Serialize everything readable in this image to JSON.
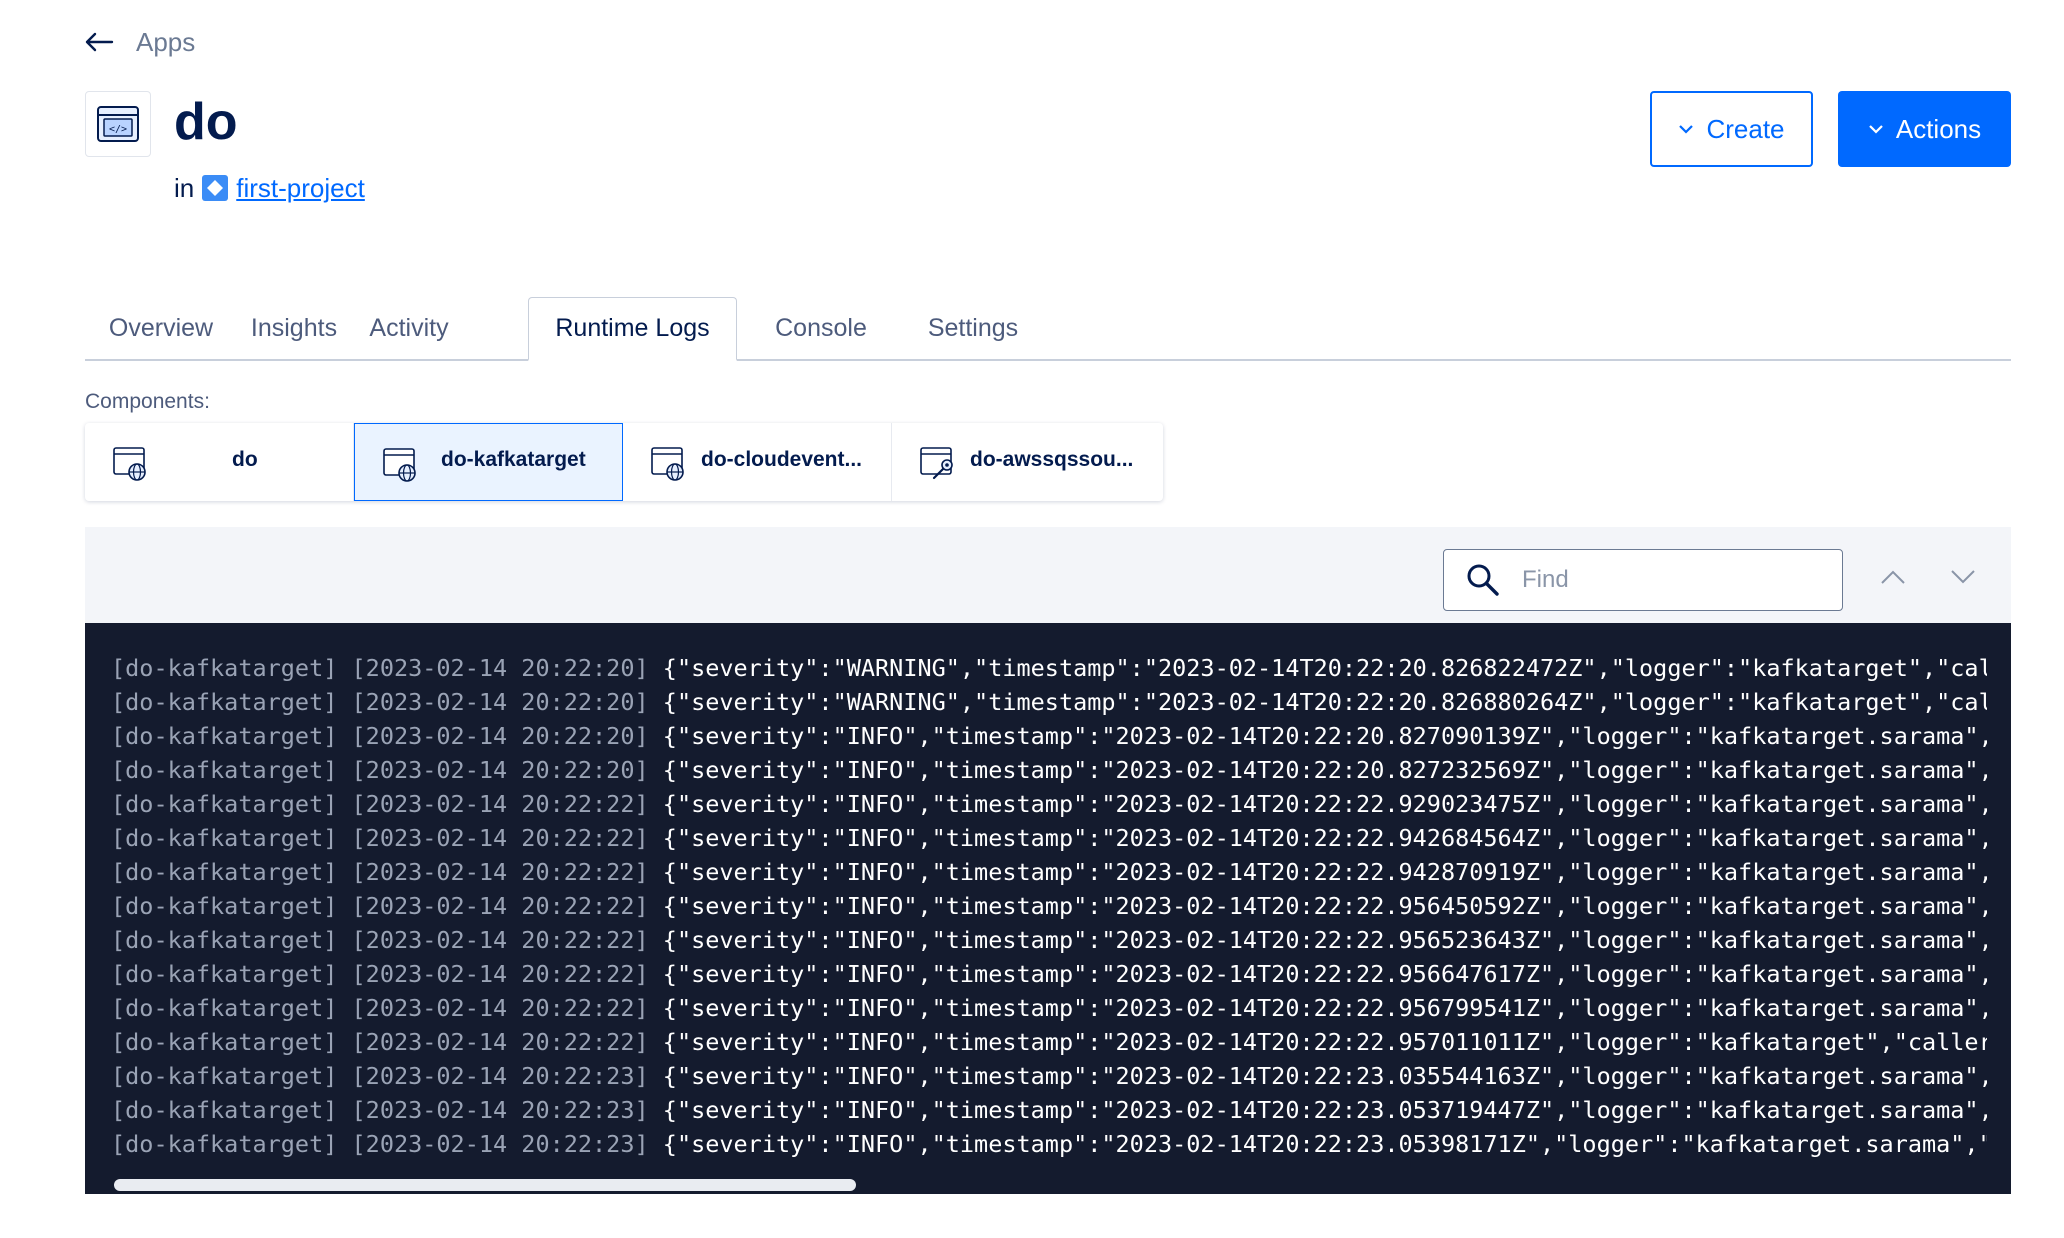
{
  "nav": {
    "back_label": "Apps"
  },
  "app": {
    "title": "do",
    "in_label": "in",
    "project": "first-project"
  },
  "buttons": {
    "create": "Create",
    "actions": "Actions"
  },
  "tabs": [
    {
      "label": "Overview",
      "active": false
    },
    {
      "label": "Insights",
      "active": false
    },
    {
      "label": "Activity",
      "active": false
    },
    {
      "label": "Runtime Logs",
      "active": true
    },
    {
      "label": "Console",
      "active": false
    },
    {
      "label": "Settings",
      "active": false
    }
  ],
  "components": {
    "label": "Components:",
    "items": [
      {
        "name": "do",
        "icon": "web-service-icon",
        "selected": false
      },
      {
        "name": "do-kafkatarget",
        "icon": "web-service-icon",
        "selected": true
      },
      {
        "name": "do-cloudevent...",
        "icon": "web-service-icon",
        "selected": false
      },
      {
        "name": "do-awssqssou...",
        "icon": "worker-icon",
        "selected": false
      }
    ]
  },
  "logs": {
    "find_placeholder": "Find",
    "lines": [
      {
        "prefix": "[do-kafkatarget] [2023-02-14 20:22:20]",
        "msg": "{\"severity\":\"WARNING\",\"timestamp\":\"2023-02-14T20:22:20.826822472Z\",\"logger\":\"kafkatarget\",\"call"
      },
      {
        "prefix": "[do-kafkatarget] [2023-02-14 20:22:20]",
        "msg": "{\"severity\":\"WARNING\",\"timestamp\":\"2023-02-14T20:22:20.826880264Z\",\"logger\":\"kafkatarget\",\"call"
      },
      {
        "prefix": "[do-kafkatarget] [2023-02-14 20:22:20]",
        "msg": "{\"severity\":\"INFO\",\"timestamp\":\"2023-02-14T20:22:20.827090139Z\",\"logger\":\"kafkatarget.sarama\",'"
      },
      {
        "prefix": "[do-kafkatarget] [2023-02-14 20:22:20]",
        "msg": "{\"severity\":\"INFO\",\"timestamp\":\"2023-02-14T20:22:20.827232569Z\",\"logger\":\"kafkatarget.sarama\",'"
      },
      {
        "prefix": "[do-kafkatarget] [2023-02-14 20:22:22]",
        "msg": "{\"severity\":\"INFO\",\"timestamp\":\"2023-02-14T20:22:22.929023475Z\",\"logger\":\"kafkatarget.sarama\",'"
      },
      {
        "prefix": "[do-kafkatarget] [2023-02-14 20:22:22]",
        "msg": "{\"severity\":\"INFO\",\"timestamp\":\"2023-02-14T20:22:22.942684564Z\",\"logger\":\"kafkatarget.sarama\",'"
      },
      {
        "prefix": "[do-kafkatarget] [2023-02-14 20:22:22]",
        "msg": "{\"severity\":\"INFO\",\"timestamp\":\"2023-02-14T20:22:22.942870919Z\",\"logger\":\"kafkatarget.sarama\",'"
      },
      {
        "prefix": "[do-kafkatarget] [2023-02-14 20:22:22]",
        "msg": "{\"severity\":\"INFO\",\"timestamp\":\"2023-02-14T20:22:22.956450592Z\",\"logger\":\"kafkatarget.sarama\",'"
      },
      {
        "prefix": "[do-kafkatarget] [2023-02-14 20:22:22]",
        "msg": "{\"severity\":\"INFO\",\"timestamp\":\"2023-02-14T20:22:22.956523643Z\",\"logger\":\"kafkatarget.sarama\",'"
      },
      {
        "prefix": "[do-kafkatarget] [2023-02-14 20:22:22]",
        "msg": "{\"severity\":\"INFO\",\"timestamp\":\"2023-02-14T20:22:22.956647617Z\",\"logger\":\"kafkatarget.sarama\",'"
      },
      {
        "prefix": "[do-kafkatarget] [2023-02-14 20:22:22]",
        "msg": "{\"severity\":\"INFO\",\"timestamp\":\"2023-02-14T20:22:22.956799541Z\",\"logger\":\"kafkatarget.sarama\",'"
      },
      {
        "prefix": "[do-kafkatarget] [2023-02-14 20:22:22]",
        "msg": "{\"severity\":\"INFO\",\"timestamp\":\"2023-02-14T20:22:22.957011011Z\",\"logger\":\"kafkatarget\",\"caller'"
      },
      {
        "prefix": "[do-kafkatarget] [2023-02-14 20:22:23]",
        "msg": "{\"severity\":\"INFO\",\"timestamp\":\"2023-02-14T20:22:23.035544163Z\",\"logger\":\"kafkatarget.sarama\",'"
      },
      {
        "prefix": "[do-kafkatarget] [2023-02-14 20:22:23]",
        "msg": "{\"severity\":\"INFO\",\"timestamp\":\"2023-02-14T20:22:23.053719447Z\",\"logger\":\"kafkatarget.sarama\",'"
      },
      {
        "prefix": "[do-kafkatarget] [2023-02-14 20:22:23]",
        "msg": "{\"severity\":\"INFO\",\"timestamp\":\"2023-02-14T20:22:23.05398171Z\",\"logger\":\"kafkatarget.sarama\",\"c"
      }
    ]
  },
  "colors": {
    "brand": "#0069ff",
    "text": "#031b4e",
    "log_background": "#141b2e",
    "toolbar_background": "#f3f5f9"
  }
}
